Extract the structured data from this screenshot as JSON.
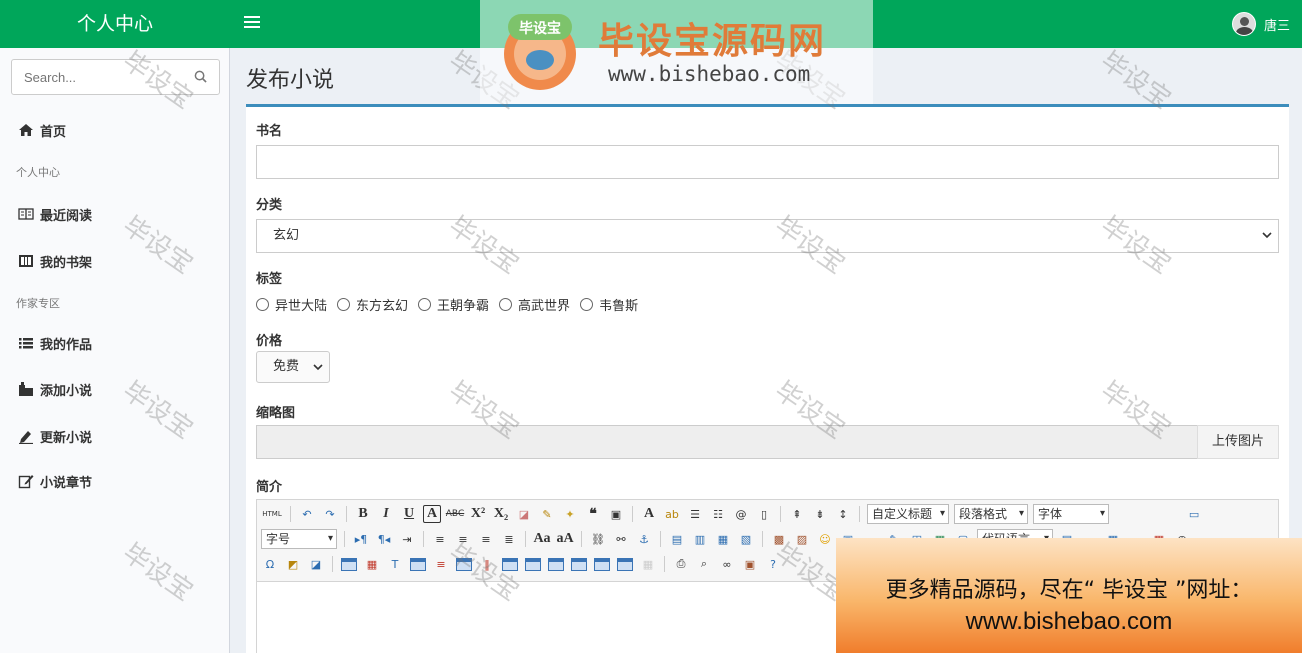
{
  "topbar": {
    "brand": "个人中心",
    "username": "唐三"
  },
  "sidebar": {
    "search_placeholder": "Search...",
    "items": [
      {
        "label": "首页",
        "icon": "home-icon"
      },
      {
        "header": "个人中心"
      },
      {
        "label": "最近阅读",
        "icon": "book-open-icon"
      },
      {
        "label": "我的书架",
        "icon": "bookshelf-icon"
      },
      {
        "header": "作家专区"
      },
      {
        "label": "我的作品",
        "icon": "list-icon"
      },
      {
        "label": "添加小说",
        "icon": "add-book-icon"
      },
      {
        "label": "更新小说",
        "icon": "pen-icon"
      },
      {
        "label": "小说章节",
        "icon": "edit-icon"
      }
    ]
  },
  "main": {
    "title": "发布小说",
    "form": {
      "name_label": "书名",
      "name_value": "",
      "category_label": "分类",
      "category_value": "玄幻",
      "tags_label": "标签",
      "tags": [
        "异世大陆",
        "东方玄幻",
        "王朝争霸",
        "高武世界",
        "韦鲁斯"
      ],
      "price_label": "价格",
      "price_value": "免费",
      "thumb_label": "缩略图",
      "upload_label": "上传图片",
      "intro_label": "简介"
    },
    "editor": {
      "html_label": "HTML",
      "custom_title": "自定义标题",
      "paragraph_format": "段落格式",
      "font_family": "字体",
      "font_size": "字号",
      "code_lang": "代码语言"
    }
  },
  "watermark": {
    "text": "毕设宝",
    "banner_title": "毕设宝源码网",
    "banner_url": "www.bishebao.com",
    "badge": "毕设宝"
  },
  "ad": {
    "line1": "更多精品源码，尽在“ 毕设宝 ”网址：",
    "line2": "www.bishebao.com"
  },
  "colors": {
    "topbar": "#00a65a",
    "box_accent": "#3c8dbc"
  }
}
